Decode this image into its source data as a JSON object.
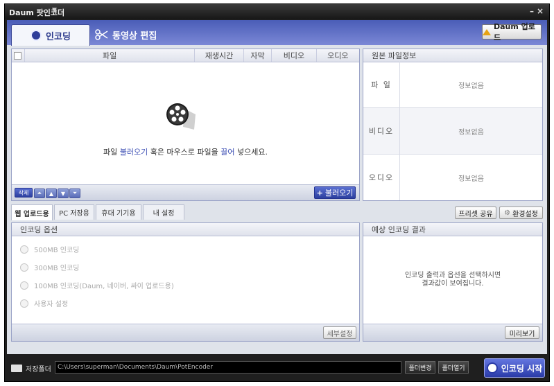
{
  "app": {
    "title": "Daum 팟인코더"
  },
  "tabs": {
    "encoding": "인코딩",
    "edit": "동영상 편집"
  },
  "upload_button": "Daum 업로드",
  "file_list": {
    "columns": [
      "파일",
      "재생시간",
      "자막",
      "비디오",
      "오디오"
    ],
    "empty_prefix": "파일 ",
    "empty_link1": "불러오기",
    "empty_mid": " 혹은 마우스로 파일을 ",
    "empty_link2": "끌어",
    "empty_suffix": " 넣으세요.",
    "delete_btn": "삭제",
    "load_btn": "불러오기"
  },
  "source_info": {
    "title": "원본 파일정보",
    "rows": [
      {
        "label": "파 일",
        "value": "정보없음"
      },
      {
        "label": "비디오",
        "value": "정보없음"
      },
      {
        "label": "오디오",
        "value": "정보없음"
      }
    ]
  },
  "sub_tabs": [
    "웹 업로드용",
    "PC 저장용",
    "휴대 기기용",
    "내 설정"
  ],
  "preset_share": "프리셋 공유",
  "settings_btn": "환경설정",
  "encoding_options": {
    "title": "인코딩 옵션",
    "options": [
      "500MB 인코딩",
      "300MB 인코딩",
      "100MB 인코딩(Daum, 네이버, 싸이 업로드용)",
      "사용자 설정"
    ],
    "detail_btn": "세부설정"
  },
  "result": {
    "title": "예상 인코딩 결과",
    "message_line1": "인코딩 출력과 옵션을 선택하시면",
    "message_line2": "결과값이 보여집니다.",
    "preview_btn": "미리보기"
  },
  "footer": {
    "folder_label": "저장폴더",
    "path": "C:\\Users\\superman\\Documents\\Daum\\PotEncoder",
    "change_btn": "폴더변경",
    "open_btn": "폴더열기",
    "start_btn": "인코딩 시작"
  },
  "colors": {
    "accent": "#3f51b5",
    "header_blue": "#4a5db7",
    "dark": "#1f1f1f"
  }
}
